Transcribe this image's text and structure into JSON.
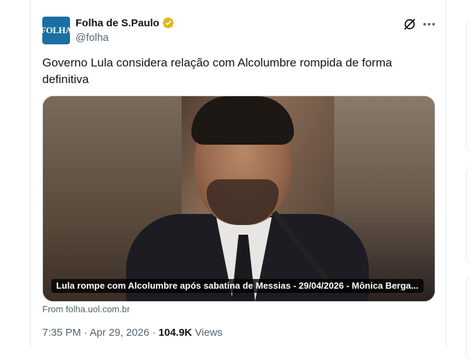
{
  "tweet": {
    "avatar_text": "FOLHA",
    "author_name": "Folha de S.Paulo",
    "author_handle": "@folha",
    "text": "Governo Lula considera relação com Alcolumbre rompida de forma definitiva",
    "media_caption": "Lula rompe com Alcolumbre após sabatina de Messias - 29/04/2026 - Mônica Berga...",
    "link_source": "From folha.uol.com.br",
    "time": "7:35 PM",
    "date": "Apr 29, 2026",
    "views_count": "104.9K",
    "views_label": "Views"
  },
  "colors": {
    "avatar_bg": "#1b6fa3",
    "verified_gold": "#e2b719",
    "secondary_text": "#536471"
  },
  "icons": [
    "verified-badge-icon",
    "grok-icon",
    "more-icon"
  ]
}
